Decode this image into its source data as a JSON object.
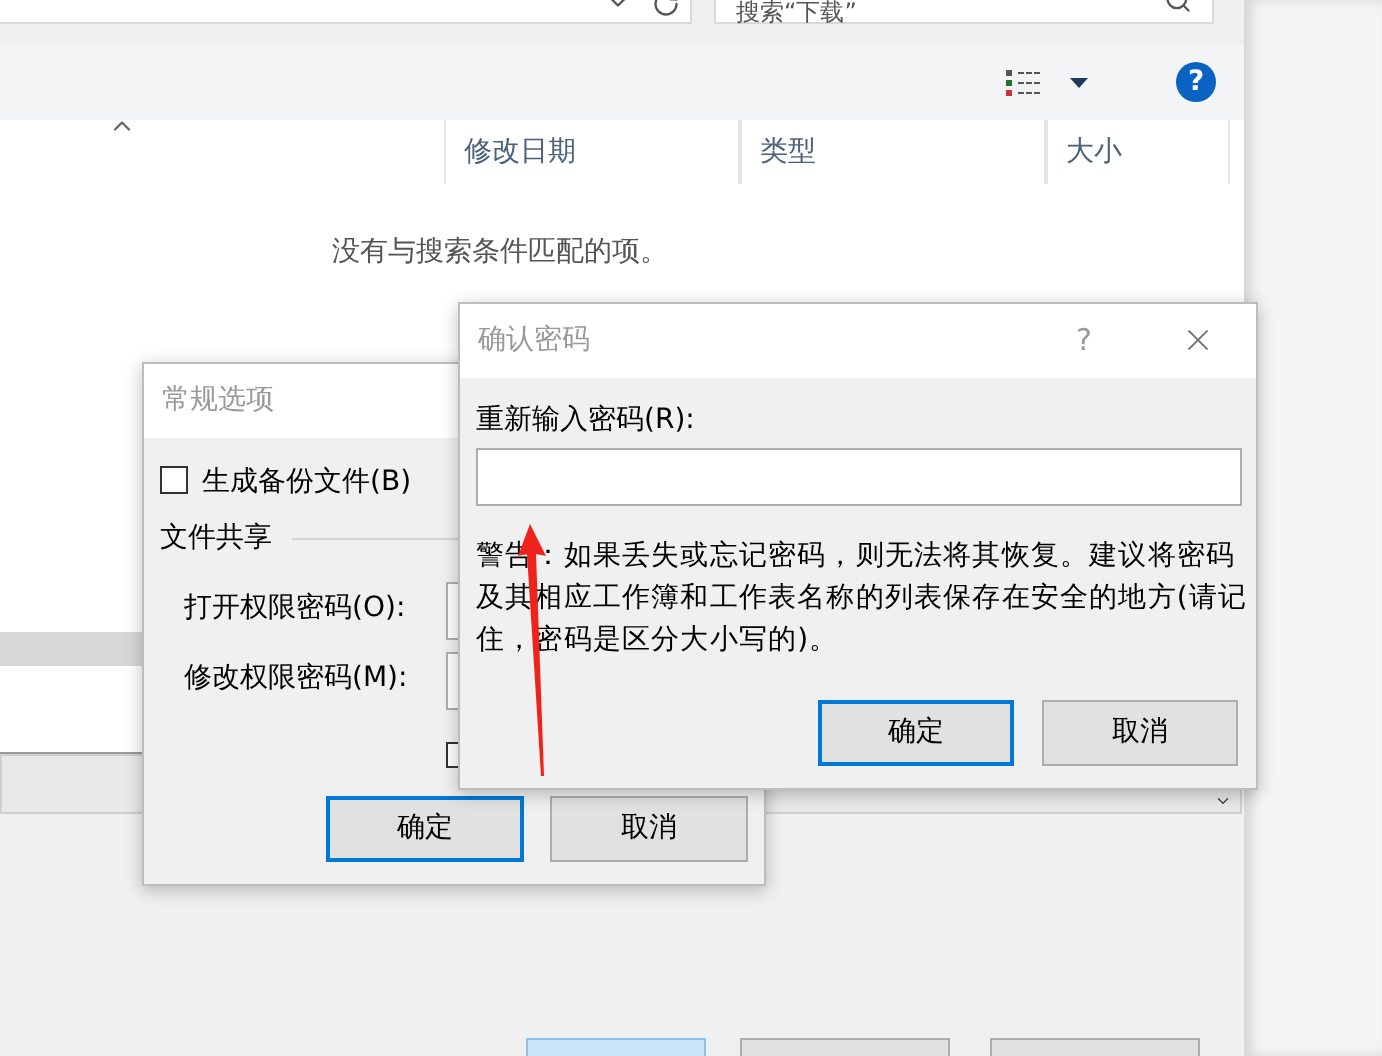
{
  "explorer": {
    "search": {
      "placeholder": "搜索“下载”"
    },
    "help": "?",
    "columns": [
      "修改日期",
      "类型",
      "大小"
    ],
    "empty_message": "没有与搜索条件匹配的项。"
  },
  "general_options": {
    "title": "常规选项",
    "backup": {
      "label": "生成备份文件(B)",
      "checked": false
    },
    "section": "文件共享",
    "fields": [
      {
        "label": "打开权限密码(O):"
      },
      {
        "label": "修改权限密码(M):"
      }
    ],
    "share_checkbox": {
      "checked": false
    },
    "buttons": [
      {
        "label": "确定",
        "kind": "default"
      },
      {
        "label": "取消",
        "kind": "normal"
      }
    ]
  },
  "confirm_password": {
    "title": "确认密码",
    "help": "?",
    "label": "重新输入密码(R):",
    "warning": "警告：如果丢失或忘记密码，则无法将其恢复。建议将密码及其相应工作簿和工作表名称的列表保存在安全的地方(请记住，密码是区分大小写的)。",
    "buttons": [
      {
        "label": "确定",
        "kind": "default"
      },
      {
        "label": "取消",
        "kind": "normal"
      }
    ]
  }
}
